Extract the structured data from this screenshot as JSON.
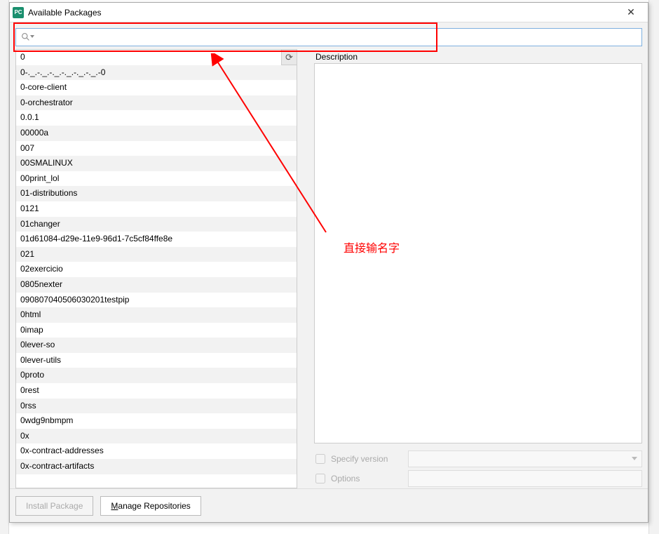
{
  "window": {
    "title": "Available Packages",
    "app_icon_label": "PC",
    "close_glyph": "✕"
  },
  "search": {
    "value": "",
    "placeholder": ""
  },
  "reload_glyph": "⟳",
  "packages": [
    "0",
    "0-._.-._.-._.-._.-._.-._.-0",
    "0-core-client",
    "0-orchestrator",
    "0.0.1",
    "00000a",
    "007",
    "00SMALINUX",
    "00print_lol",
    "01-distributions",
    "0121",
    "01changer",
    "01d61084-d29e-11e9-96d1-7c5cf84ffe8e",
    "021",
    "02exercicio",
    "0805nexter",
    "090807040506030201testpip",
    "0html",
    "0imap",
    "0lever-so",
    "0lever-utils",
    "0proto",
    "0rest",
    "0rss",
    "0wdg9nbmpm",
    "0x",
    "0x-contract-addresses",
    "0x-contract-artifacts"
  ],
  "right": {
    "description_label": "Description",
    "specify_version_label": "Specify version",
    "specify_version_value": "",
    "options_label": "Options",
    "options_value": ""
  },
  "footer": {
    "install_label": "Install Package",
    "manage_label_pre": "M",
    "manage_label_rest": "anage Repositories"
  },
  "annotation": {
    "text": "直接输名字"
  }
}
